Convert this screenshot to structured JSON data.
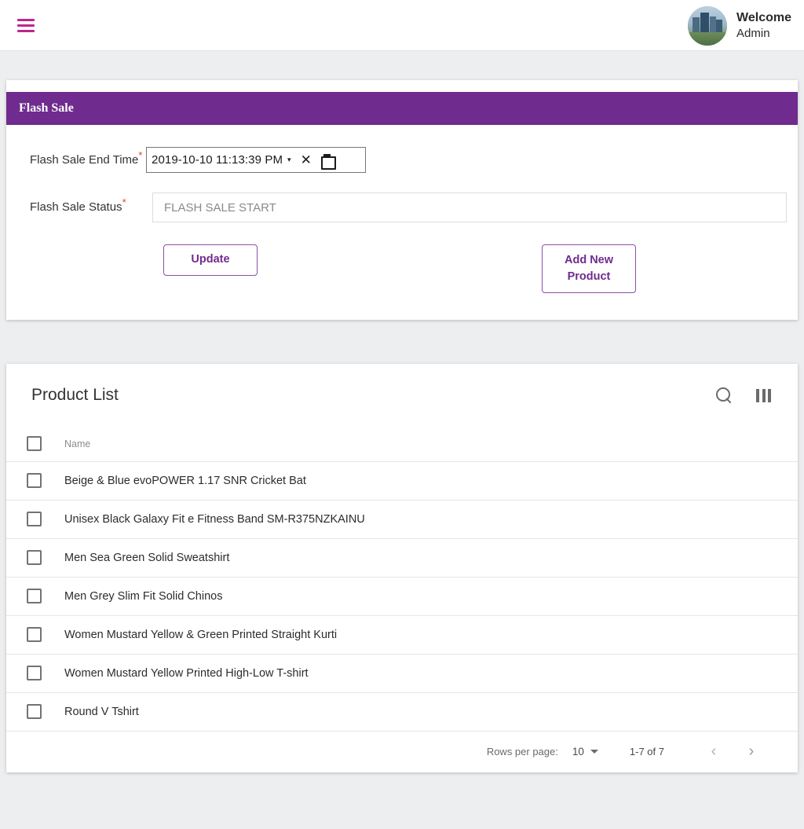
{
  "topbar": {
    "menu_icon": "hamburger-menu-icon",
    "welcome_title": "Welcome",
    "welcome_subtitle": "Admin",
    "accent_color": "#bd2590"
  },
  "flash_sale": {
    "header_title": "Flash Sale",
    "header_color": "#702b8e",
    "end_time": {
      "label": "Flash Sale End Time",
      "required_marker": "*",
      "value": "2019-10-10 11:13:39 PM",
      "caret": "▾",
      "clear_glyph": "✕"
    },
    "status": {
      "label": "Flash Sale Status",
      "required_marker": "*",
      "value": "FLASH SALE START"
    },
    "buttons": {
      "update_label": "Update",
      "add_new_product_label": "Add New Product"
    }
  },
  "product_list": {
    "title": "Product List",
    "search_icon": "search-icon",
    "columns_icon": "view-column-icon",
    "columns": [
      "Name"
    ],
    "rows": [
      {
        "name": "Beige & Blue evoPOWER 1.17 SNR Cricket Bat"
      },
      {
        "name": "Unisex Black Galaxy Fit e Fitness Band SM-R375NZKAINU"
      },
      {
        "name": "Men Sea Green Solid Sweatshirt"
      },
      {
        "name": "Men Grey Slim Fit Solid Chinos"
      },
      {
        "name": "Women Mustard Yellow & Green Printed Straight Kurti"
      },
      {
        "name": "Women Mustard Yellow Printed High-Low T-shirt"
      },
      {
        "name": "Round V Tshirt"
      }
    ],
    "pagination": {
      "rows_per_page_label": "Rows per page:",
      "rows_per_page_value": "10",
      "range_label": "1-7 of 7",
      "prev_glyph": "‹",
      "next_glyph": "›"
    }
  }
}
